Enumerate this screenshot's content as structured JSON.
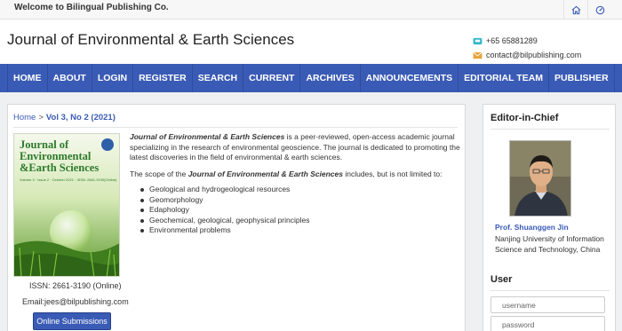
{
  "topbar": {
    "welcome": "Welcome to Bilingual Publishing Co.",
    "icons": [
      "home-icon",
      "dashboard-icon"
    ]
  },
  "header": {
    "journal_title": "Journal of Environmental & Earth Sciences",
    "phone": "+65 65881289",
    "email": "contact@bilpublishing.com"
  },
  "nav": {
    "items": [
      "HOME",
      "ABOUT",
      "LOGIN",
      "REGISTER",
      "SEARCH",
      "CURRENT",
      "ARCHIVES",
      "ANNOUNCEMENTS",
      "EDITORIAL TEAM",
      "PUBLISHER"
    ]
  },
  "breadcrumb": {
    "home": "Home",
    "separator": ">",
    "current": "Vol 3, No 2 (2021)"
  },
  "cover": {
    "title_line1": "Journal of",
    "title_line2": "Environmental",
    "title_line3": "&Earth Sciences",
    "subtitle": "Volume 3 · Issue 2 · October 2021 · ISSN: 2661-3190(Online)"
  },
  "issn": "ISSN: 2661-3190 (Online)",
  "journal_email": "Email:jees@bilpublishing.com",
  "submit_button": "Online Submissions",
  "description": {
    "journal_name": "Journal of Environmental & Earth Sciences",
    "text": " is a peer-reviewed, open-access academic journal specializing in the research of environmental geoscience. The journal is dedicated to promoting the latest discoveries in the field of environmental & earth sciences.",
    "scope_prefix": "The scope of the ",
    "scope_journal": "Journal of Environmental & Earth Sciences",
    "scope_suffix": "  includes, but is not limited to:",
    "topics": [
      "Geological and hydrogeological resources",
      "Geomorphology",
      "Edaphology",
      "Geochemical, geological, geophysical principles",
      "Environmental problems"
    ]
  },
  "sidebar": {
    "editor_heading": "Editor-in-Chief",
    "editor_name": "Prof. Shuanggen Jin",
    "editor_affiliation": "Nanjing University of Information Science and Technology, China",
    "user_heading": "User",
    "username_placeholder": "username",
    "password_placeholder": "password"
  },
  "colors": {
    "nav": "#3a5bb5",
    "link": "#3a5bb5",
    "cover_green": "#2d7a2d"
  }
}
